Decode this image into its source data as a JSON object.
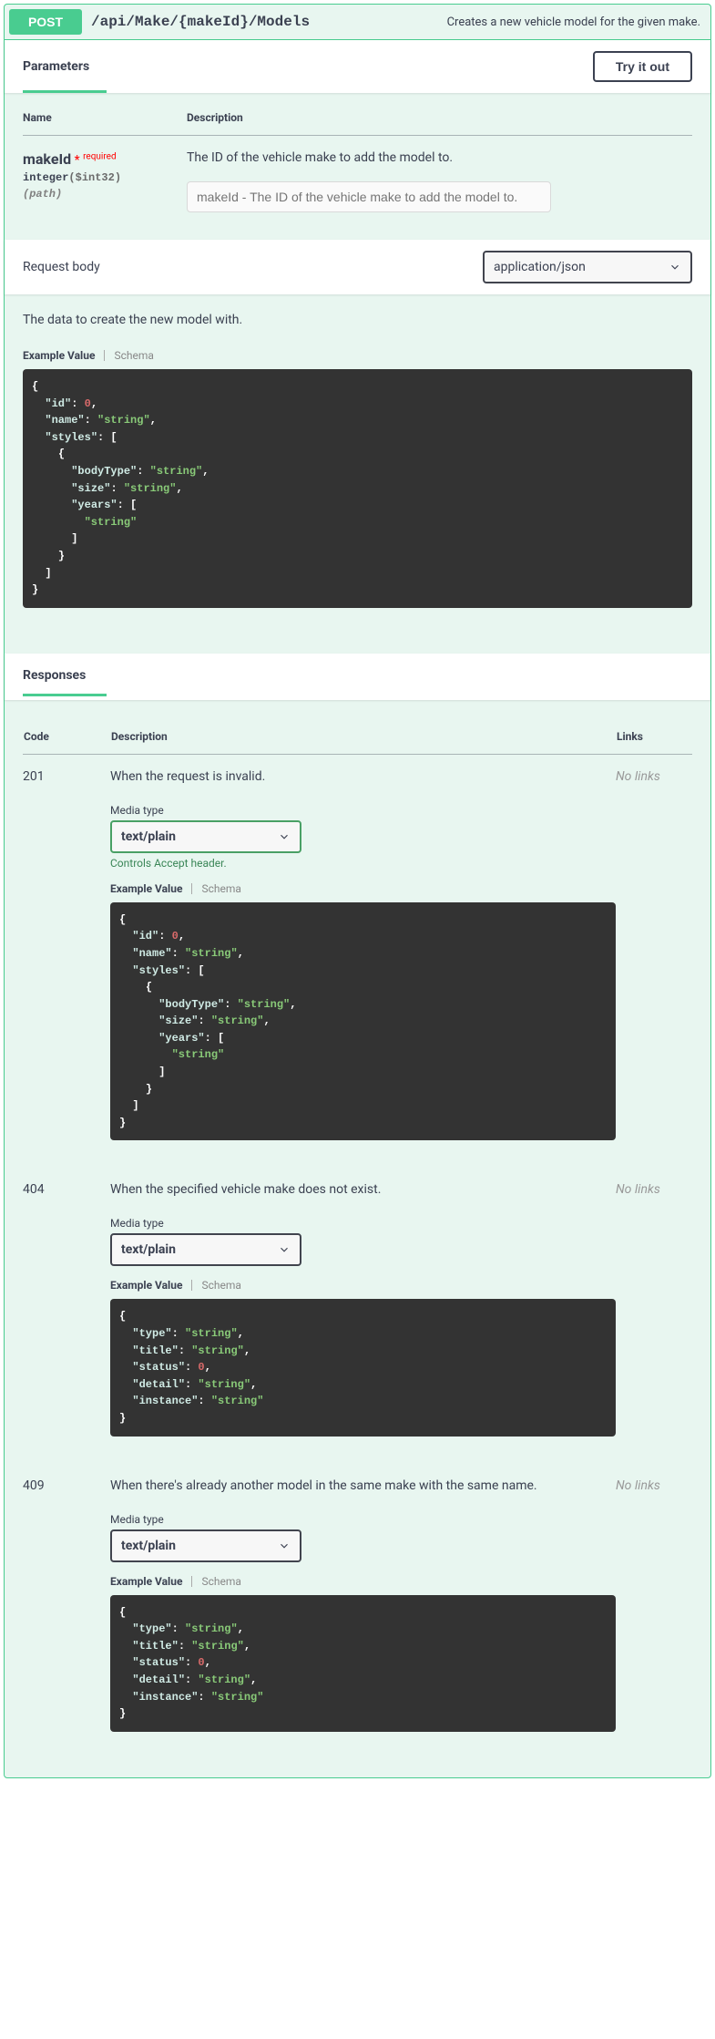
{
  "method": "POST",
  "path": "/api/Make/{makeId}/Models",
  "summary": "Creates a new vehicle model for the given make.",
  "parameters_title": "Parameters",
  "try_label": "Try it out",
  "col_name": "Name",
  "col_desc": "Description",
  "param": {
    "name": "makeId",
    "required": "required",
    "type": "integer",
    "format": "($int32)",
    "in": "(path)",
    "description": "The ID of the vehicle make to add the model to.",
    "placeholder": "makeId - The ID of the vehicle make to add the model to."
  },
  "reqbody_label": "Request body",
  "reqbody_content_type": "application/json",
  "reqbody_description": "The data to create the new model with.",
  "tab_example": "Example Value",
  "tab_schema": "Schema",
  "responses_title": "Responses",
  "resp_col_code": "Code",
  "resp_col_desc": "Description",
  "resp_col_links": "Links",
  "no_links": "No links",
  "media_type_label": "Media type",
  "text_plain": "text/plain",
  "controls_accept": "Controls Accept header.",
  "responses": {
    "r201": {
      "code": "201",
      "desc": "When the request is invalid."
    },
    "r404": {
      "code": "404",
      "desc": "When the specified vehicle make does not exist."
    },
    "r409": {
      "code": "409",
      "desc": "When there's already another model in the same make with the same name."
    }
  },
  "code_keys": {
    "id": "\"id\"",
    "name": "\"name\"",
    "styles": "\"styles\"",
    "bodyType": "\"bodyType\"",
    "size": "\"size\"",
    "years": "\"years\"",
    "type": "\"type\"",
    "title": "\"title\"",
    "status": "\"status\"",
    "detail": "\"detail\"",
    "instance": "\"instance\""
  },
  "code_vals": {
    "zero": "0",
    "string": "\"string\""
  }
}
